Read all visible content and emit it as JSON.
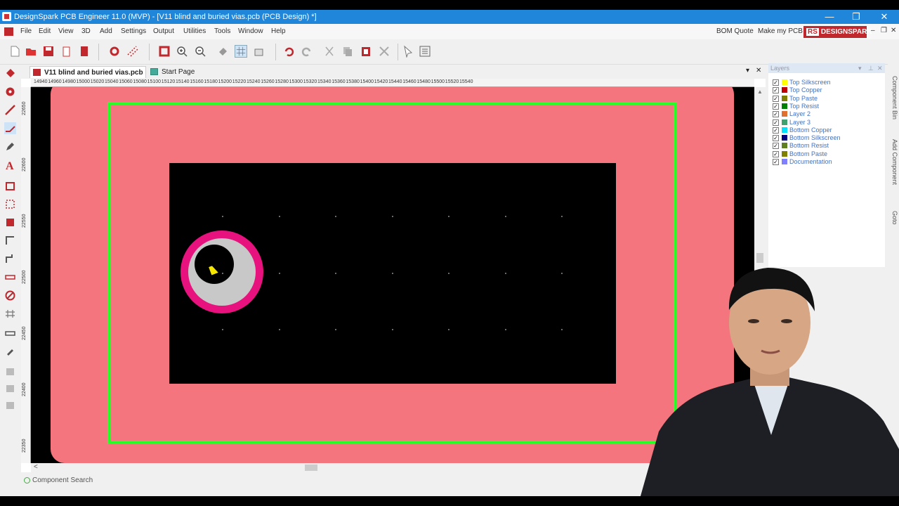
{
  "window": {
    "title": "DesignSpark PCB Engineer 11.0  (MVP) - [V11 blind and buried vias.pcb (PCB Design) *]",
    "controls": {
      "minimize": "—",
      "restore": "❐",
      "close": "✕"
    }
  },
  "menu": {
    "items": [
      "File",
      "Edit",
      "View",
      "3D",
      "Add",
      "Settings",
      "Output",
      "Utilities",
      "Tools",
      "Window",
      "Help"
    ],
    "right_links": [
      "BOM Quote",
      "Make my PCB"
    ],
    "brand_rs": "RS",
    "brand_name": "DESIGNSPARK",
    "mdi_controls": {
      "minimize": "–",
      "restore": "❐",
      "close": "✕"
    }
  },
  "tabs": [
    {
      "label": "V11 blind and buried vias.pcb",
      "active": true
    },
    {
      "label": "Start Page",
      "active": false
    }
  ],
  "tab_controls": {
    "dropdown": "▾",
    "close": "✕"
  },
  "ruler": {
    "horizontal": [
      "14940",
      "14960",
      "14980",
      "15000",
      "15020",
      "15040",
      "15060",
      "15080",
      "15100",
      "15120",
      "15140",
      "15160",
      "15180",
      "15200",
      "15220",
      "15240",
      "15260",
      "15280",
      "15300",
      "15320",
      "15340",
      "15360",
      "15380",
      "15400",
      "15420",
      "15440",
      "15460",
      "15480",
      "15500",
      "15520",
      "15540"
    ],
    "vertical": [
      "22650",
      "22600",
      "22550",
      "22500",
      "22450",
      "22400",
      "22350"
    ]
  },
  "canvas": {
    "board_color": "#f4757d",
    "outline_color": "#26ff26",
    "via_pad_color": "#e8127e",
    "via_ring_color": "#c8c8c8",
    "background": "#000000"
  },
  "scroll": {
    "left_arrow": "<",
    "up_arrow": "▲"
  },
  "status": {
    "component_search": "Component Search"
  },
  "layers_panel": {
    "title": "Layers",
    "controls": {
      "dropdown": "▾",
      "pin": "⊥",
      "close": "✕"
    },
    "layers": [
      {
        "name": "Top Silkscreen",
        "color": "#ffff00",
        "checked": true
      },
      {
        "name": "Top Copper",
        "color": "#c00000",
        "checked": true
      },
      {
        "name": "Top Paste",
        "color": "#808000",
        "checked": true
      },
      {
        "name": "Top Resist",
        "color": "#008000",
        "checked": true
      },
      {
        "name": "Layer 2",
        "color": "#e07030",
        "checked": true
      },
      {
        "name": "Layer 3",
        "color": "#40a070",
        "checked": true
      },
      {
        "name": "Bottom Copper",
        "color": "#00e0ff",
        "checked": true
      },
      {
        "name": "Bottom Silkscreen",
        "color": "#000080",
        "checked": true
      },
      {
        "name": "Bottom Resist",
        "color": "#608020",
        "checked": true
      },
      {
        "name": "Bottom Paste",
        "color": "#808000",
        "checked": true
      },
      {
        "name": "Documentation",
        "color": "#8080ff",
        "checked": true
      }
    ]
  },
  "side_tabs": [
    "Component Bin",
    "Add Component",
    "Goto"
  ]
}
